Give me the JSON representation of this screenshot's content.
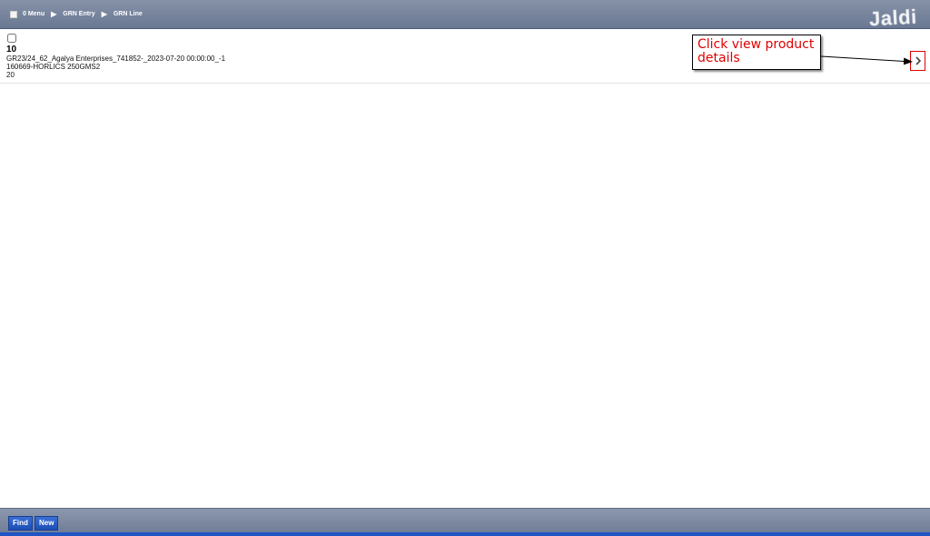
{
  "breadcrumb": {
    "items": [
      "0 Menu",
      "GRN Entry",
      "GRN Line"
    ]
  },
  "logo": {
    "text": "Jaldi"
  },
  "record": {
    "line_no": "10",
    "grn_ref": "GR23/24_62_Agalya Enterprises_741852-_2023-07-20 00:00:00_-1",
    "product": "160669-HORLICS 250GMS2",
    "quantity": "20"
  },
  "annotation": {
    "text": "Click view product details",
    "color": "#e00000"
  },
  "footer": {
    "find_label": "Find",
    "new_label": "New"
  },
  "colors": {
    "toolbar": "#7584a0",
    "button": "#2a5cc4"
  }
}
